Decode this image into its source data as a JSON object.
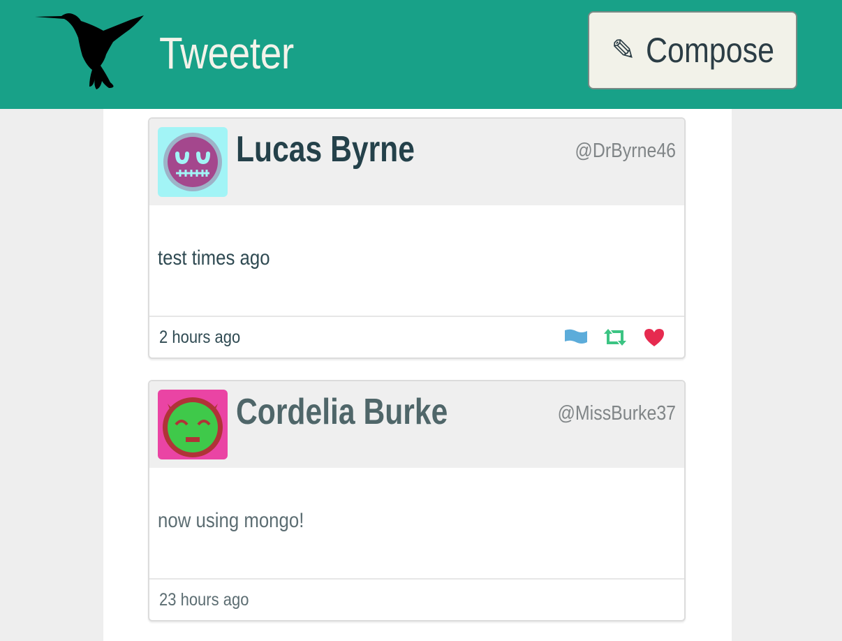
{
  "header": {
    "title": "Tweeter",
    "compose_label": "Compose",
    "compose_icon": "pencil-icon",
    "background_color": "#18a188",
    "logo_icon": "hummingbird-logo-icon"
  },
  "tweets": [
    {
      "author": "Lucas Byrne",
      "handle": "@DrByrne46",
      "body": "test times ago",
      "time": "2 hours ago",
      "author_color": "#24414a",
      "body_color": "#2f4a52",
      "avatar": {
        "bg": "#a2f4f6",
        "face": "#a4478d",
        "ring": "#9db3c8"
      },
      "actions": [
        "flag-icon",
        "retweet-icon",
        "heart-icon"
      ],
      "action_colors": {
        "flag": "#5cacda",
        "retweet": "#3cc483",
        "heart": "#e62a4f"
      }
    },
    {
      "author": "Cordelia Burke",
      "handle": "@MissBurke37",
      "body": "now using mongo!",
      "time": "23 hours ago",
      "author_color": "#4f6669",
      "body_color": "#5c6d72",
      "avatar": {
        "bg": "#ea44a4",
        "face": "#3fc94a",
        "ring": "#b03337"
      },
      "actions": []
    }
  ]
}
